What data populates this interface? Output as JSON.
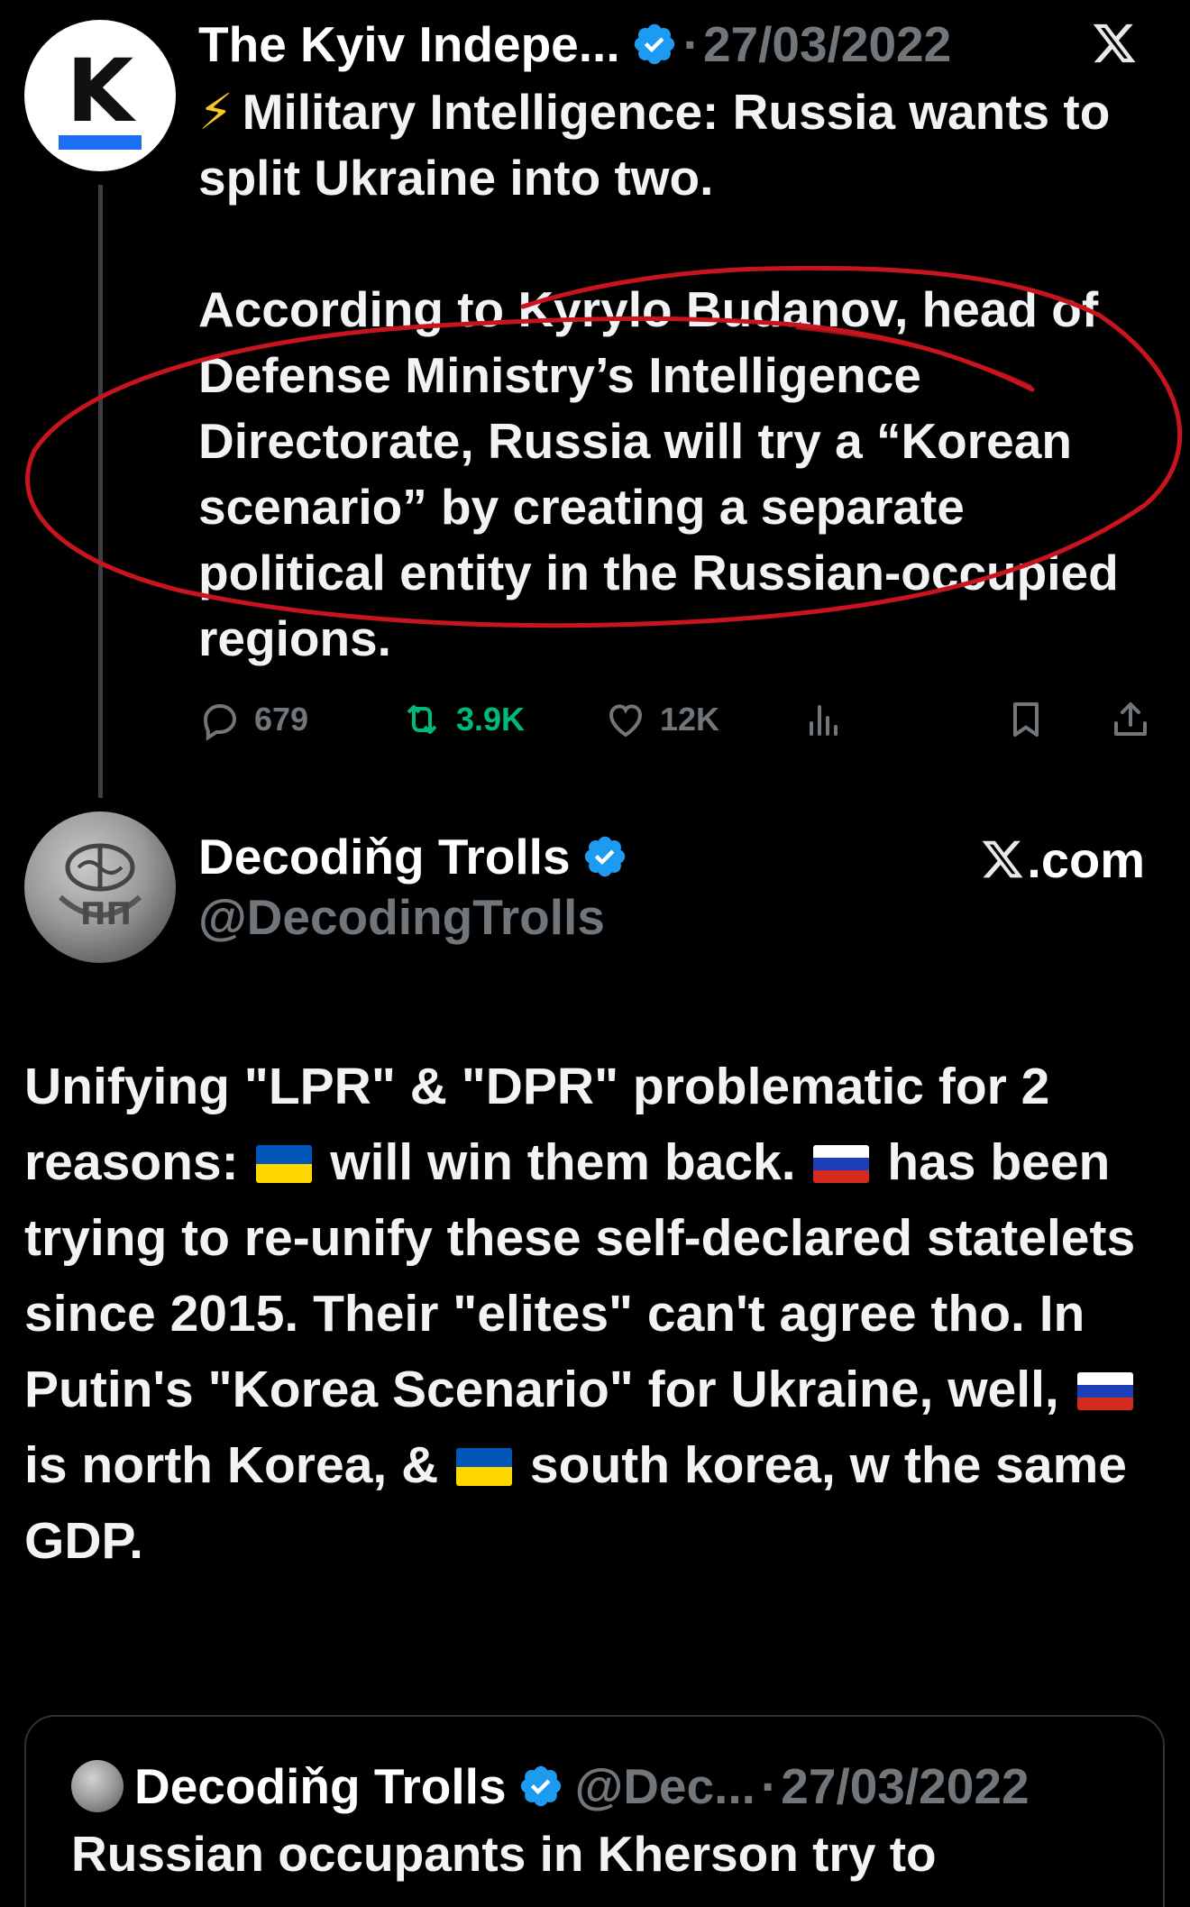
{
  "tweet1": {
    "author_name": "The Kyiv Indepe...",
    "separator": "·",
    "date": "27/03/2022",
    "avatar_letter": "K",
    "bolt": "⚡",
    "headline": "Military Intelligence: Russia wants to split Ukraine into two.",
    "paragraph": "According to Kyrylo Budanov, head of Defense Ministry’s Intelligence Directorate, Russia will try a “Korean scenario” by creating a separate political entity in the Russian-occupied regions.",
    "actions": {
      "replies": "679",
      "retweets": "3.9K",
      "likes": "12K"
    },
    "colors": {
      "verified": "#1d9bf0",
      "retweet": "#00ba7c",
      "annotation": "#c8141c",
      "logo_bar": "#1d6ff2"
    }
  },
  "tweet2": {
    "author_name": "Decodiňg Trolls",
    "handle": "@DecodingTrolls",
    "source_label": ".com",
    "body": {
      "part1": "Unifying \"LPR\" & \"DPR\" problematic for 2 reasons:",
      "part2": "will win them back.",
      "part3": "has been trying to re-unify these self-declared statelets since 2015. Their \"elites\" can't agree tho. In Putin's \"Korea Scenario\" for Ukraine, well,",
      "part4": "is north Korea, &",
      "part5": "south korea, w the same GDP."
    },
    "flags": [
      "ukraine-flag",
      "russia-flag",
      "russia-flag",
      "ukraine-flag"
    ]
  },
  "quote": {
    "author_name": "Decodiňg Trolls",
    "handle": "@Dec...",
    "separator": "·",
    "date": "27/03/2022",
    "text": "Russian occupants in Kherson try to"
  }
}
